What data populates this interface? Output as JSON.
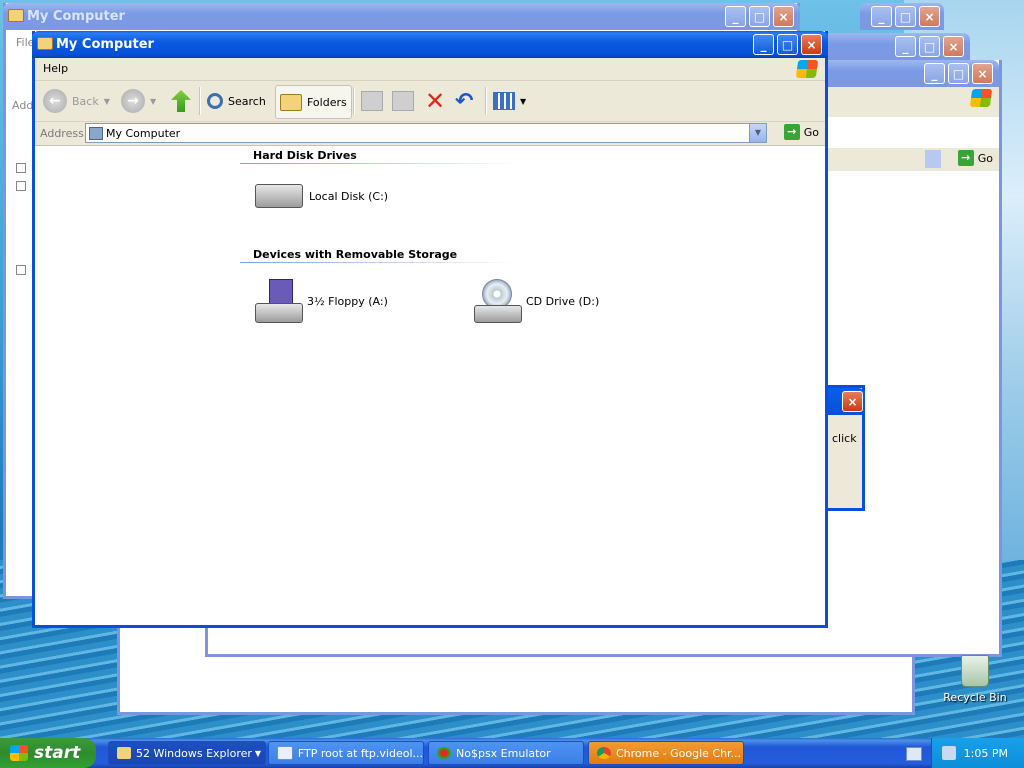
{
  "windows_bg": [
    {
      "title": "My Computer",
      "menu_partial": "File"
    },
    {
      "title": "",
      "menu_partial": ""
    },
    {
      "title": "",
      "menu_partial": ""
    }
  ],
  "main_window": {
    "title": "My Computer",
    "menu": {
      "help": "Help"
    },
    "toolbar": {
      "back": "Back",
      "search": "Search",
      "folders": "Folders"
    },
    "address": {
      "label": "Address",
      "value": "My Computer",
      "go": "Go"
    },
    "groups": [
      {
        "header": "Hard Disk Drives",
        "items": [
          "Local Disk (C:)"
        ]
      },
      {
        "header": "Devices with Removable Storage",
        "items": [
          "3½ Floppy (A:)",
          "CD Drive (D:)"
        ]
      }
    ]
  },
  "back_window_partial": {
    "address_label": "Add",
    "go": "Go"
  },
  "dialog": {
    "text": "click"
  },
  "desktop": {
    "recycle_bin": "Recycle Bin"
  },
  "taskbar": {
    "start": "start",
    "tasks": [
      {
        "label": "52 Windows Explorer",
        "state": "active"
      },
      {
        "label": "FTP root at ftp.videol...",
        "state": "normal"
      },
      {
        "label": "No$psx Emulator",
        "state": "normal"
      },
      {
        "label": "Chrome - Google Chr...",
        "state": "flashing"
      }
    ],
    "clock": "1:05 PM"
  }
}
